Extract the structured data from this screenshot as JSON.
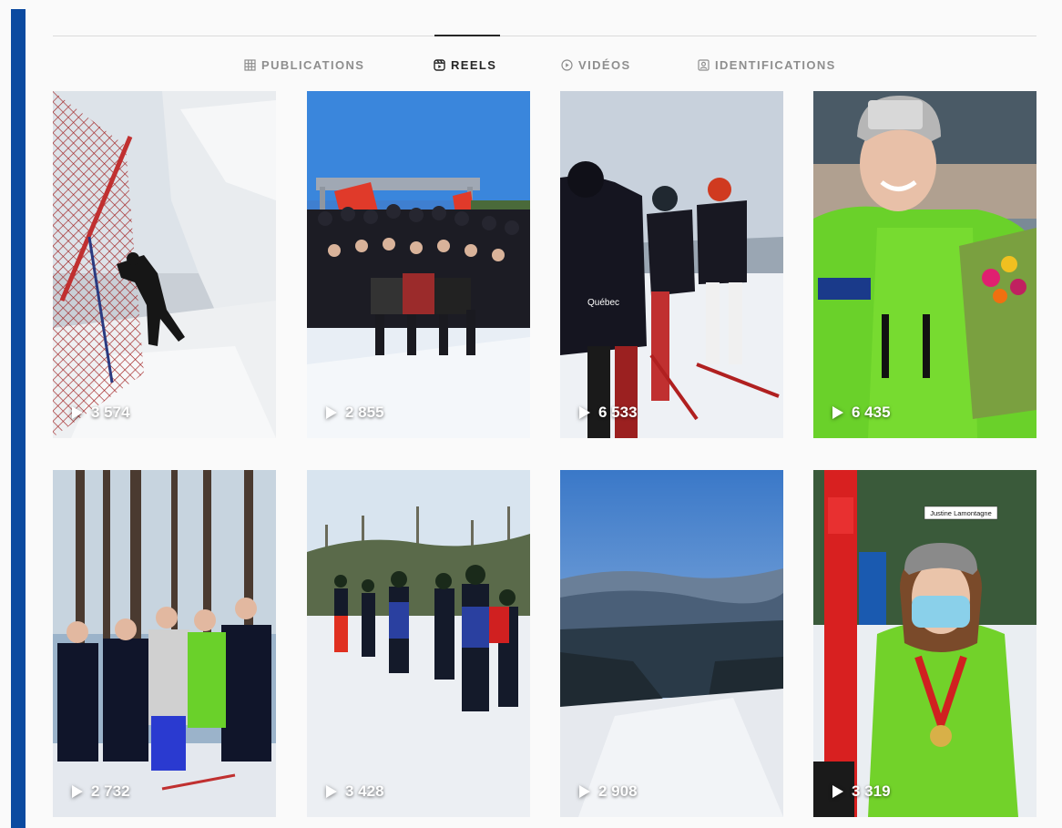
{
  "tabs": [
    {
      "label": "PUBLICATIONS",
      "icon": "grid-icon",
      "active": false
    },
    {
      "label": "REELS",
      "icon": "reels-icon",
      "active": true
    },
    {
      "label": "VIDÉOS",
      "icon": "video-icon",
      "active": false
    },
    {
      "label": "IDENTIFICATIONS",
      "icon": "tag-icon",
      "active": false
    }
  ],
  "reels": [
    {
      "views": "3 574"
    },
    {
      "views": "2 855"
    },
    {
      "views": "6 533"
    },
    {
      "views": "6 435"
    },
    {
      "views": "2 732"
    },
    {
      "views": "3 428"
    },
    {
      "views": "2 908"
    },
    {
      "views": "3 319"
    }
  ],
  "overlays": {
    "name_tag": "Justine Lamontagne",
    "jacket_text": "Québec"
  },
  "colors": {
    "accent_bar": "#0b4aa0",
    "active_tab": "#262626",
    "inactive_tab": "#8e8e8e"
  }
}
